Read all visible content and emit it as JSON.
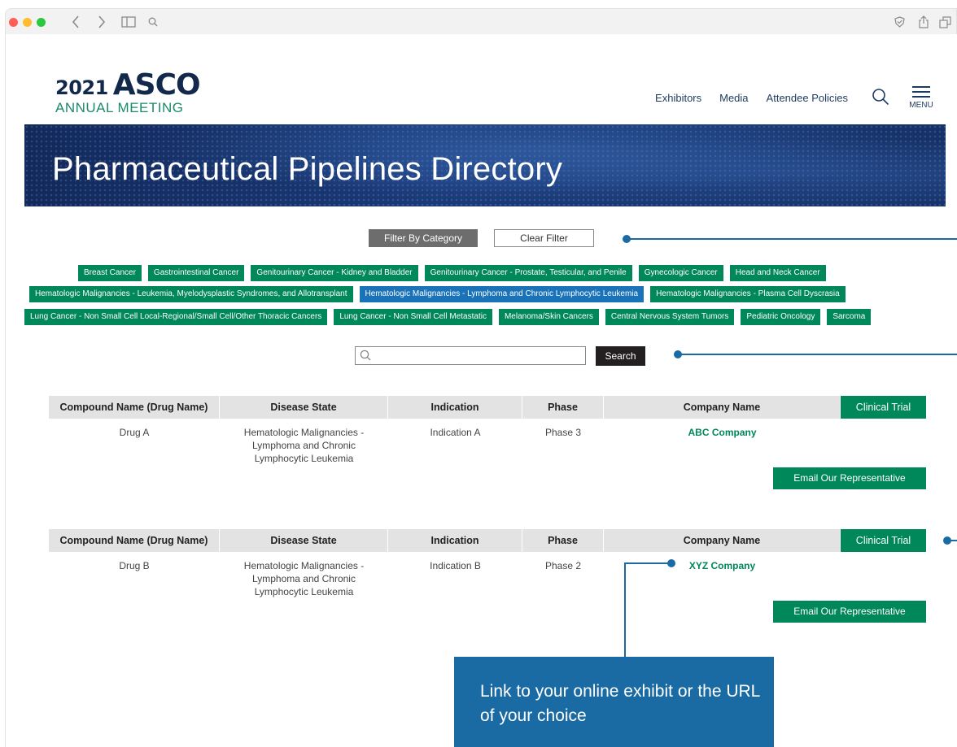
{
  "browser": {
    "traffic_colors": [
      "#ff5f57",
      "#febc2e",
      "#28c840"
    ]
  },
  "header": {
    "logo_year": "2021",
    "logo_name": "ASCO",
    "logo_sub": "ANNUAL MEETING",
    "nav": [
      "Exhibitors",
      "Media",
      "Attendee Policies"
    ],
    "menu_label": "MENU"
  },
  "banner": {
    "title": "Pharmaceutical Pipelines Directory"
  },
  "filters": {
    "filter_label": "Filter By Category",
    "clear_label": "Clear Filter",
    "active_category": "Hematologic Malignancies - Lymphoma and Chronic Lymphocytic Leukemia",
    "rows": [
      [
        "Breast Cancer",
        "Gastrointestinal Cancer",
        "Genitourinary Cancer - Kidney and Bladder",
        "Genitourinary Cancer - Prostate, Testicular, and Penile",
        "Gynecologic Cancer",
        "Head and Neck Cancer"
      ],
      [
        "Hematologic Malignancies - Leukemia, Myelodysplastic Syndromes, and Allotransplant",
        "Hematologic Malignancies - Lymphoma and Chronic Lymphocytic Leukemia",
        "Hematologic Malignancies - Plasma Cell Dyscrasia"
      ],
      [
        "Lung Cancer - Non Small Cell Local-Regional/Small Cell/Other Thoracic Cancers",
        "Lung Cancer - Non Small Cell Metastatic",
        "Melanoma/Skin Cancers",
        "Central Nervous System Tumors",
        "Pediatric Oncology",
        "Sarcoma"
      ]
    ]
  },
  "search": {
    "value": "",
    "placeholder": "",
    "button": "Search"
  },
  "table": {
    "headers": [
      "Compound Name (Drug Name)",
      "Disease State",
      "Indication",
      "Phase",
      "Company Name",
      "Clinical Trial"
    ],
    "email_label": "Email Our Representative",
    "rows": [
      {
        "compound": "Drug A",
        "disease": "Hematologic Malignancies - Lymphoma and Chronic Lymphocytic Leukemia",
        "indication": "Indication A",
        "phase": "Phase 3",
        "company": "ABC Company"
      },
      {
        "compound": "Drug B",
        "disease": "Hematologic Malignancies - Lymphoma and Chronic Lymphocytic Leukemia",
        "indication": "Indication B",
        "phase": "Phase 2",
        "company": "XYZ Company"
      }
    ]
  },
  "callout": {
    "text": "Link to your online exhibit or the URL of your choice"
  },
  "colors": {
    "green": "#00875a",
    "blue": "#1a72b8",
    "navy": "#13294b",
    "annotation": "#1a6ba3"
  }
}
